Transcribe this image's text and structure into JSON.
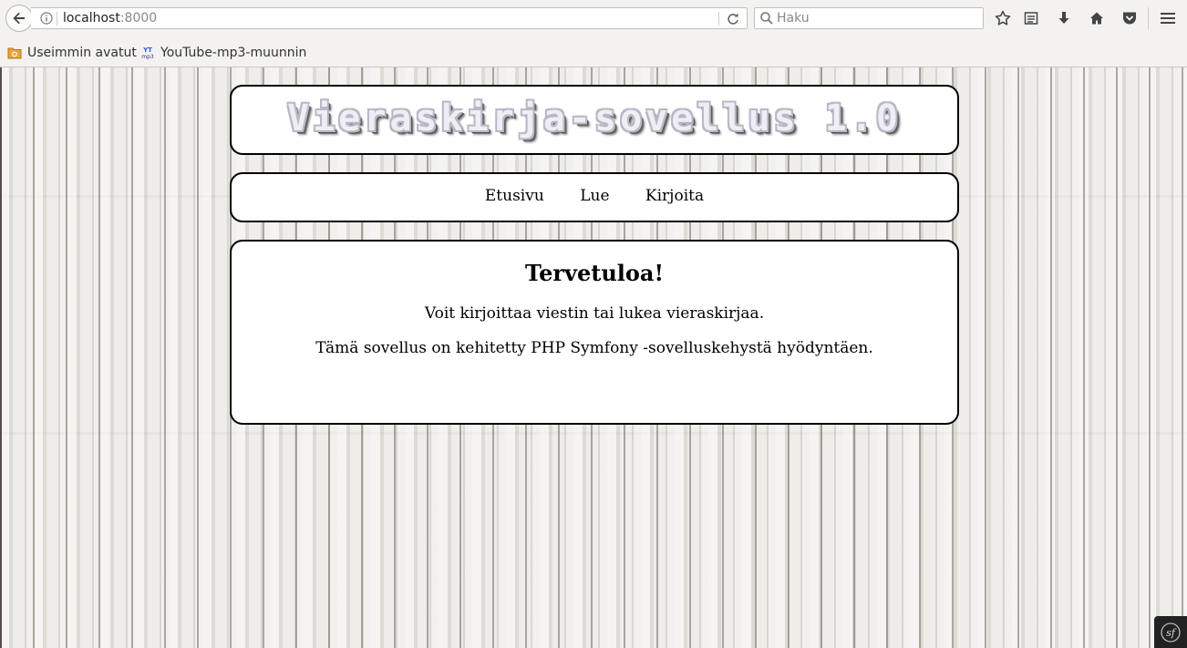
{
  "browser": {
    "url_host": "localhost",
    "url_port": ":8000",
    "search_placeholder": "Haku",
    "bookmarks": [
      {
        "label": "Useimmin avatut",
        "icon": "folder-icon"
      },
      {
        "label": "YouTube-mp3-muunnin",
        "icon": "yt-mp3-icon"
      }
    ],
    "toolbar_icons": [
      "bookmark-star-icon",
      "reading-list-icon",
      "downloads-icon",
      "home-icon",
      "pocket-icon",
      "menu-icon"
    ]
  },
  "page": {
    "site_title": "Vieraskirja-sovellus 1.0",
    "nav": [
      "Etusivu",
      "Lue",
      "Kirjoita"
    ],
    "heading": "Tervetuloa!",
    "paragraphs": [
      "Voit kirjoittaa viestin tai lukea vieraskirjaa.",
      "Tämä sovellus on kehitetty PHP Symfony -sovelluskehystä hyödyntäen."
    ],
    "debug_badge_icon": "symfony-icon"
  },
  "colors": {
    "panel_border": "#000000",
    "panel_bg": "#ffffff",
    "chrome_bg": "#f3f2f1"
  }
}
